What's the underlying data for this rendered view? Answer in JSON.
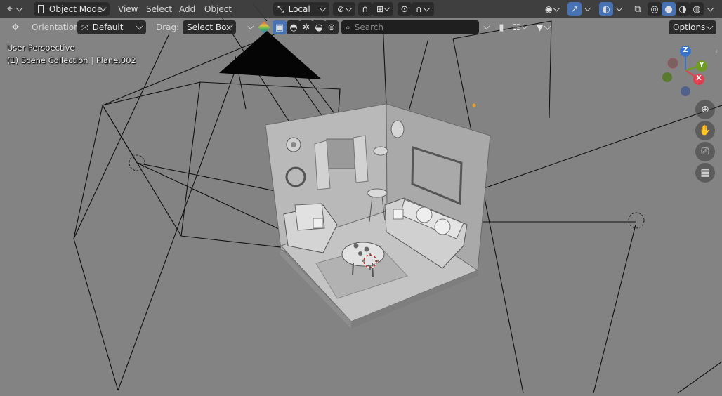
{
  "header": {
    "editor_type_icon": "axes-icon",
    "mode": "Object Mode",
    "menus": [
      "View",
      "Select",
      "Add",
      "Object"
    ],
    "transform_pivot": "Local",
    "snap_icon": "magnet-icon",
    "proportional_icon": "falloff-icon"
  },
  "tool_header": {
    "orientation_label": "Orientation:",
    "orientation_value": "Default",
    "drag_label": "Drag:",
    "drag_value": "Select Box",
    "search_placeholder": "Search",
    "options_label": "Options"
  },
  "viewport": {
    "perspective": "User Perspective",
    "collection_info": "(1) Scene Collection | Plane.002"
  },
  "gizmo": {
    "x_label": "X",
    "y_label": "Y",
    "z_label": "Z",
    "x_color": "#e0404f",
    "y_color": "#6e9b24",
    "z_color": "#3a72c8"
  },
  "colors": {
    "accent": "#4772b3",
    "header_bg": "#3a3a3a",
    "viewport_bg": "#838383"
  }
}
